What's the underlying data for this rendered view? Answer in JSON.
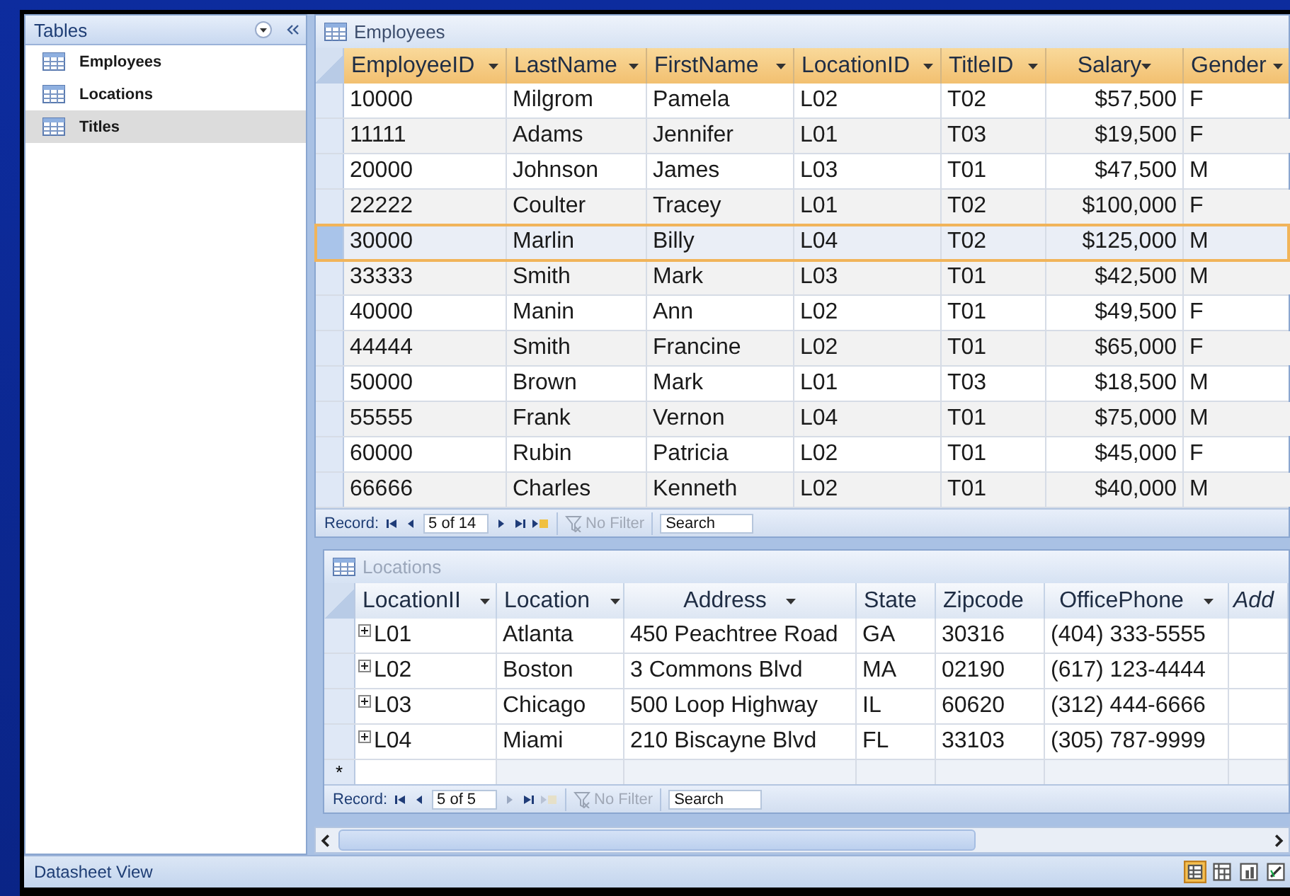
{
  "nav_pane": {
    "title": "Tables",
    "items": [
      {
        "label": "Employees",
        "selected": false
      },
      {
        "label": "Locations",
        "selected": false
      },
      {
        "label": "Titles",
        "selected": true
      }
    ]
  },
  "employees": {
    "title": "Employees",
    "columns": [
      {
        "label": "EmployeeID",
        "kind": "text"
      },
      {
        "label": "LastName",
        "kind": "text"
      },
      {
        "label": "FirstName",
        "kind": "text"
      },
      {
        "label": "LocationID",
        "kind": "text"
      },
      {
        "label": "TitleID",
        "kind": "text"
      },
      {
        "label": "Salary",
        "kind": "currency"
      },
      {
        "label": "Gender",
        "kind": "text"
      }
    ],
    "rows": [
      {
        "cells": [
          "10000",
          "Milgrom",
          "Pamela",
          "L02",
          "T02",
          "$57,500",
          "F"
        ],
        "selected": false
      },
      {
        "cells": [
          "11111",
          "Adams",
          "Jennifer",
          "L01",
          "T03",
          "$19,500",
          "F"
        ],
        "selected": false
      },
      {
        "cells": [
          "20000",
          "Johnson",
          "James",
          "L03",
          "T01",
          "$47,500",
          "M"
        ],
        "selected": false
      },
      {
        "cells": [
          "22222",
          "Coulter",
          "Tracey",
          "L01",
          "T02",
          "$100,000",
          "F"
        ],
        "selected": false
      },
      {
        "cells": [
          "30000",
          "Marlin",
          "Billy",
          "L04",
          "T02",
          "$125,000",
          "M"
        ],
        "selected": true
      },
      {
        "cells": [
          "33333",
          "Smith",
          "Mark",
          "L03",
          "T01",
          "$42,500",
          "M"
        ],
        "selected": false
      },
      {
        "cells": [
          "40000",
          "Manin",
          "Ann",
          "L02",
          "T01",
          "$49,500",
          "F"
        ],
        "selected": false
      },
      {
        "cells": [
          "44444",
          "Smith",
          "Francine",
          "L02",
          "T01",
          "$65,000",
          "F"
        ],
        "selected": false
      },
      {
        "cells": [
          "50000",
          "Brown",
          "Mark",
          "L01",
          "T03",
          "$18,500",
          "M"
        ],
        "selected": false
      },
      {
        "cells": [
          "55555",
          "Frank",
          "Vernon",
          "L04",
          "T01",
          "$75,000",
          "M"
        ],
        "selected": false
      },
      {
        "cells": [
          "60000",
          "Rubin",
          "Patricia",
          "L02",
          "T01",
          "$45,000",
          "F"
        ],
        "selected": false
      },
      {
        "cells": [
          "66666",
          "Charles",
          "Kenneth",
          "L02",
          "T01",
          "$40,000",
          "M"
        ],
        "selected": false
      }
    ],
    "record_nav": {
      "label": "Record:",
      "position": "5 of 14",
      "filter": "No Filter",
      "search": "Search"
    }
  },
  "locations": {
    "title": "Locations",
    "columns": [
      {
        "label": "LocationII",
        "kind": "text"
      },
      {
        "label": "Location",
        "kind": "text"
      },
      {
        "label": "Address",
        "kind": "center"
      },
      {
        "label": "State",
        "kind": "text"
      },
      {
        "label": "Zipcode",
        "kind": "text"
      },
      {
        "label": "OfficePhone",
        "kind": "center"
      }
    ],
    "add_column": "Add",
    "rows": [
      {
        "cells": [
          "L01",
          "Atlanta",
          "450 Peachtree Road",
          "GA",
          "30316",
          "(404) 333-5555"
        ]
      },
      {
        "cells": [
          "L02",
          "Boston",
          "3 Commons Blvd",
          "MA",
          "02190",
          "(617) 123-4444"
        ]
      },
      {
        "cells": [
          "L03",
          "Chicago",
          "500 Loop Highway",
          "IL",
          "60620",
          "(312) 444-6666"
        ]
      },
      {
        "cells": [
          "L04",
          "Miami",
          "210 Biscayne Blvd",
          "FL",
          "33103",
          "(305) 787-9999"
        ]
      }
    ],
    "new_row_marker": "*",
    "record_nav": {
      "label": "Record:",
      "position": "5 of 5",
      "filter": "No Filter",
      "search": "Search"
    }
  },
  "status_bar": {
    "text": "Datasheet View"
  }
}
